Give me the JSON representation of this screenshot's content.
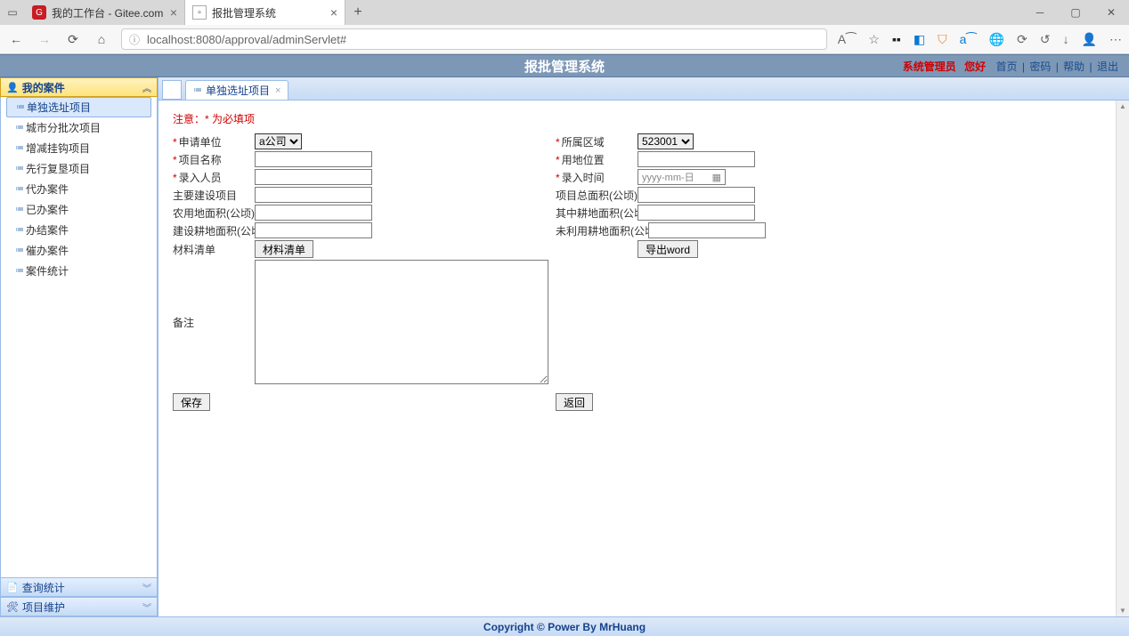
{
  "browser": {
    "tabs": [
      {
        "title": "我的工作台 - Gitee.com",
        "active": false
      },
      {
        "title": "报批管理系统",
        "active": true
      }
    ],
    "url": "localhost:8080/approval/adminServlet#"
  },
  "app": {
    "title": "报批管理系统",
    "admin_label": "系统管理员",
    "greeting": "您好",
    "nav_links": {
      "home": "首页",
      "password": "密码",
      "help": "帮助",
      "logout": "退出"
    }
  },
  "sidebar": {
    "panels": {
      "my_cases": {
        "title": "我的案件"
      },
      "query_stats": {
        "title": "查询统计"
      },
      "project_maint": {
        "title": "项目维护"
      }
    },
    "items": [
      {
        "label": "单独选址项目",
        "active": true
      },
      {
        "label": "城市分批次项目"
      },
      {
        "label": "增减挂钩项目"
      },
      {
        "label": "先行复垦项目"
      },
      {
        "label": "代办案件"
      },
      {
        "label": "已办案件"
      },
      {
        "label": "办结案件"
      },
      {
        "label": "催办案件"
      },
      {
        "label": "案件统计"
      }
    ]
  },
  "content_tab": {
    "title": "单独选址项目"
  },
  "form": {
    "notice": "注意：* 为必填项",
    "labels": {
      "apply_unit": "申请单位",
      "region": "所属区域",
      "project_name": "项目名称",
      "land_location": "用地位置",
      "entry_person": "录入人员",
      "entry_time": "录入时间",
      "main_build": "主要建设项目",
      "total_area": "项目总面积(公顷)",
      "farm_area": "农用地面积(公顷)",
      "cultivated_area": "其中耕地面积(公顷)",
      "build_cultivated": "建设耕地面积(公顷)",
      "unused_cultivated": "未利用耕地面积(公顷)",
      "material_list": "材料清单",
      "remark": "备注"
    },
    "apply_unit_value": "a公司",
    "region_value": "523001",
    "date_placeholder": "yyyy-mm-日",
    "buttons": {
      "material_list": "材料清单",
      "export_word": "导出word",
      "save": "保存",
      "back": "返回"
    }
  },
  "footer": "Copyright © Power By MrHuang"
}
